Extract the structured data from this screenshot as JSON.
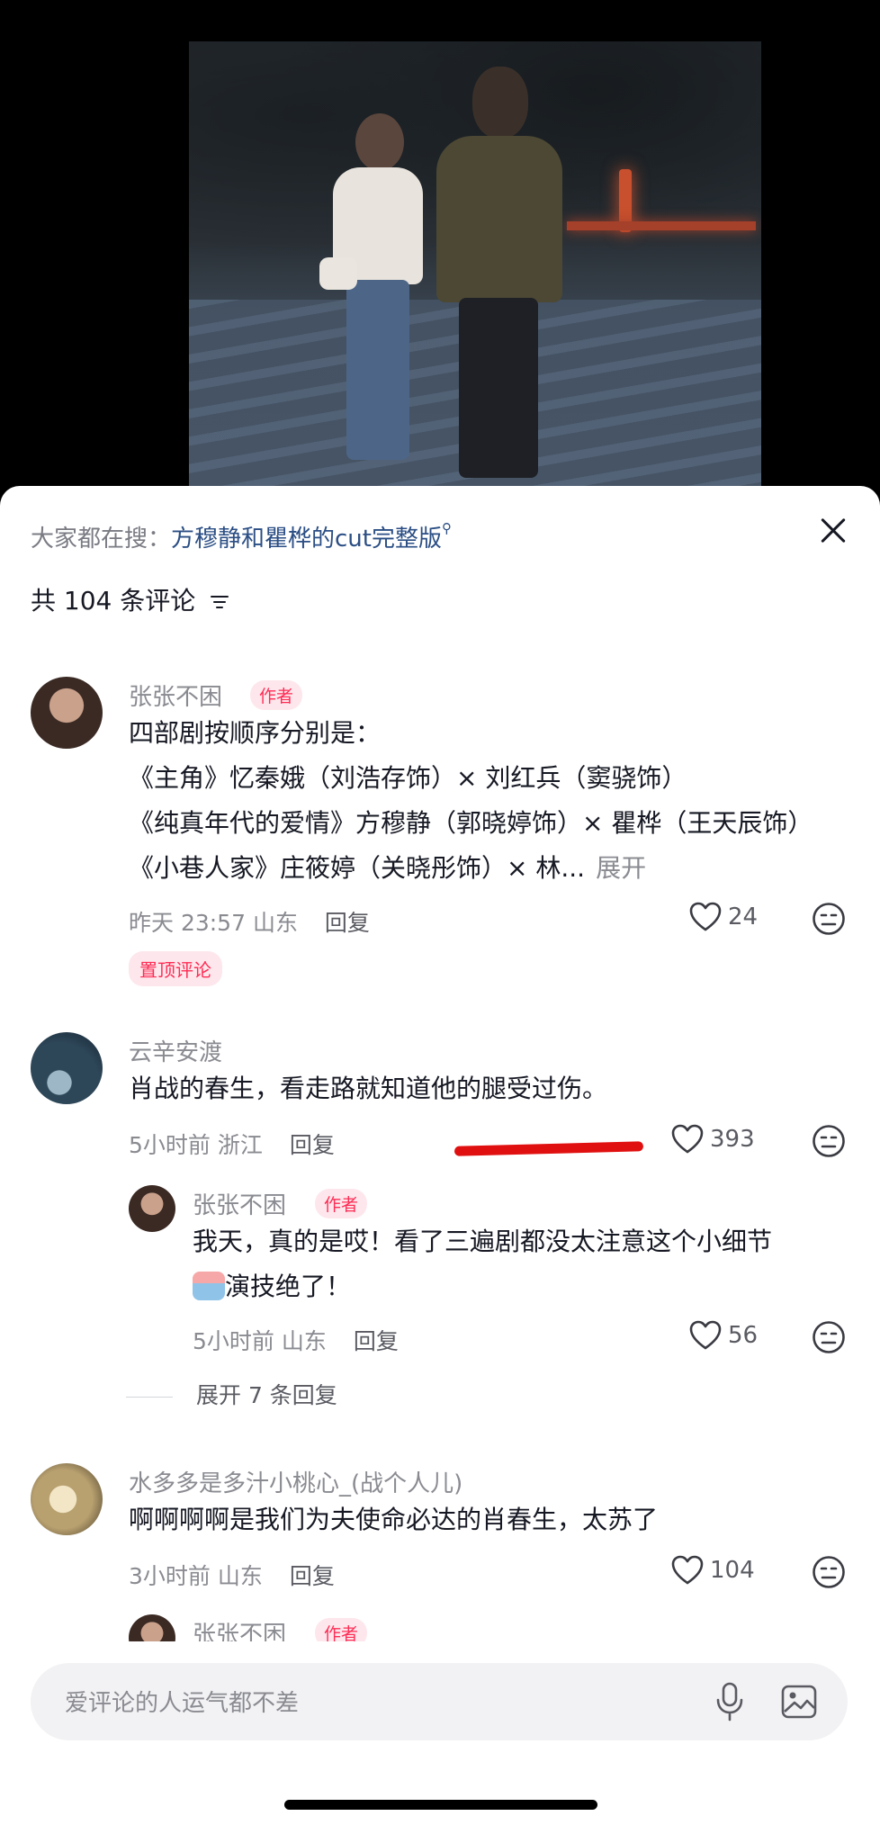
{
  "search_hint": {
    "prefix": "大家都在搜：",
    "query": "方穆静和瞿桦的cut完整版",
    "mag": "⚲"
  },
  "comments_header": {
    "count_label": "共 104 条评论"
  },
  "comments": [
    {
      "author": "张张不困",
      "author_tag": "作者",
      "lines": [
        "四部剧按顺序分别是：",
        "《主角》忆秦娥（刘浩存饰）× 刘红兵（窦骁饰）",
        "《纯真年代的爱情》方穆静（郭晓婷饰）× 瞿桦（王天辰饰）",
        "《小巷人家》庄筱婷（关晓彤饰）× 林..."
      ],
      "expand_label": "展开",
      "time": "昨天 23:57",
      "location": "山东",
      "reply_label": "回复",
      "likes": "24",
      "pinned_label": "置顶评论"
    },
    {
      "author": "云辛安渡",
      "text": "肖战的春生，看走路就知道他的腿受过伤。",
      "time": "5小时前",
      "location": "浙江",
      "reply_label": "回复",
      "likes": "393",
      "reply": {
        "author": "张张不困",
        "author_tag": "作者",
        "line1": "我天，真的是哎！看了三遍剧都没太注意这个小细节",
        "line2": "演技绝了！",
        "time": "5小时前",
        "location": "山东",
        "reply_label": "回复",
        "likes": "56"
      },
      "expand_replies_label": "展开 7 条回复"
    },
    {
      "author": "水多多是多汁小桃心_(战个人儿)",
      "text": "啊啊啊啊是我们为夫使命必达的肖春生，太苏了",
      "time": "3小时前",
      "location": "山东",
      "reply_label": "回复",
      "likes": "104",
      "next_author": "张张不困",
      "next_tag": "作者"
    }
  ],
  "input": {
    "placeholder": "爱评论的人运气都不差"
  },
  "colors": {
    "accent_red": "#fe2c55",
    "link_blue": "#2b4e84",
    "underline": "#e01010"
  }
}
